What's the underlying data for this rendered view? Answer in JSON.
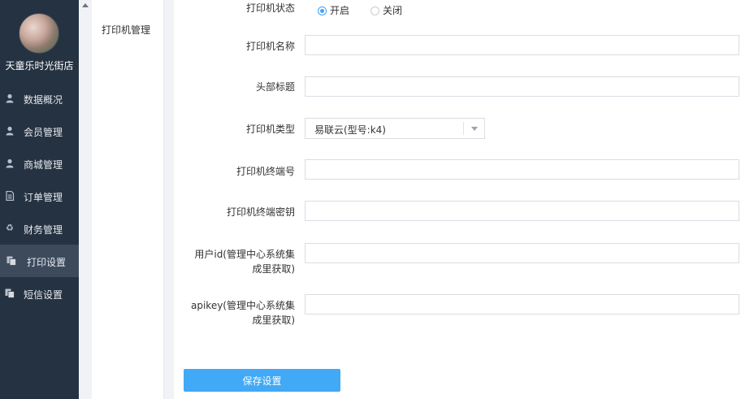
{
  "sidebar": {
    "shop_name": "天童乐时光街店",
    "items": [
      {
        "label": "数据概况",
        "icon": "user-icon"
      },
      {
        "label": "会员管理",
        "icon": "user-icon"
      },
      {
        "label": "商城管理",
        "icon": "user-icon"
      },
      {
        "label": "订单管理",
        "icon": "document-icon"
      },
      {
        "label": "财务管理",
        "icon": "recycle-icon"
      },
      {
        "label": "打印设置",
        "icon": "copy-icon",
        "active": true
      },
      {
        "label": "短信设置",
        "icon": "copy-icon"
      }
    ]
  },
  "submenu": {
    "items": [
      {
        "label": "打印机管理"
      }
    ]
  },
  "form": {
    "status": {
      "label": "打印机状态",
      "options": [
        "开启",
        "关闭"
      ],
      "selected": "开启"
    },
    "printer_name": {
      "label": "打印机名称",
      "value": ""
    },
    "header_title": {
      "label": "头部标题",
      "value": ""
    },
    "printer_type": {
      "label": "打印机类型",
      "value": "易联云(型号:k4)"
    },
    "terminal_no": {
      "label": "打印机终端号",
      "value": ""
    },
    "terminal_key": {
      "label": "打印机终端密钥",
      "value": ""
    },
    "user_id": {
      "label": "用户id(管理中心系统集成里获取)",
      "value": ""
    },
    "apikey": {
      "label": "apikey(管理中心系统集成里获取)",
      "value": ""
    },
    "save_label": "保存设置"
  },
  "colors": {
    "sidebar_bg": "#253241",
    "sidebar_active_bg": "#3c4a5c",
    "accent": "#41a9f5",
    "radio_accent": "#3fa2f7"
  }
}
